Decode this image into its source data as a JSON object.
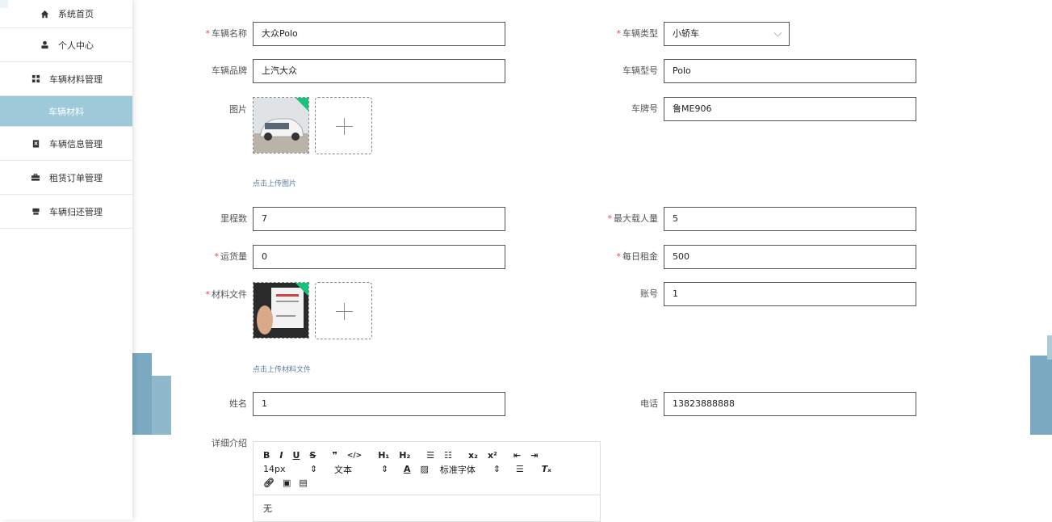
{
  "sidebar": {
    "items": [
      {
        "label": "系统首页",
        "icon": "home-icon"
      },
      {
        "label": "个人中心",
        "icon": "user-icon"
      },
      {
        "label": "车辆材料管理",
        "icon": "grid-icon"
      },
      {
        "label": "车辆材料",
        "icon": ""
      },
      {
        "label": "车辆信息管理",
        "icon": "clipboard-icon"
      },
      {
        "label": "租赁订单管理",
        "icon": "briefcase-icon"
      },
      {
        "label": "车辆归还管理",
        "icon": "inbox-icon"
      }
    ]
  },
  "form": {
    "vehicle_name": {
      "label": "车辆名称",
      "value": "大众Polo"
    },
    "vehicle_type": {
      "label": "车辆类型",
      "value": "小轿车"
    },
    "brand": {
      "label": "车辆品牌",
      "value": "上汽大众"
    },
    "model": {
      "label": "车辆型号",
      "value": "Polo"
    },
    "image": {
      "label": "图片",
      "hint": "点击上传图片"
    },
    "plate": {
      "label": "车牌号",
      "value": "鲁ME906"
    },
    "mileage": {
      "label": "里程数",
      "value": "7"
    },
    "max_passengers": {
      "label": "最大载人量",
      "value": "5"
    },
    "cargo": {
      "label": "运货量",
      "value": "0"
    },
    "daily_rent": {
      "label": "每日租金",
      "value": "500"
    },
    "material_file": {
      "label": "材料文件",
      "hint": "点击上传材料文件"
    },
    "account": {
      "label": "账号",
      "value": "1"
    },
    "name": {
      "label": "姓名",
      "value": "1"
    },
    "phone": {
      "label": "电话",
      "value": "13823888888"
    },
    "detail": {
      "label": "详细介绍",
      "content": "无"
    }
  },
  "editor": {
    "row1": [
      "B",
      "I",
      "U",
      "S",
      "99",
      "</>",
      "H1",
      "H2",
      "ol",
      "ul",
      "x₂",
      "x²",
      "outdent",
      "indent"
    ],
    "font_size": "14px",
    "text_style": "文本",
    "font_family": "标准字体",
    "size_arrow": "⇕"
  }
}
